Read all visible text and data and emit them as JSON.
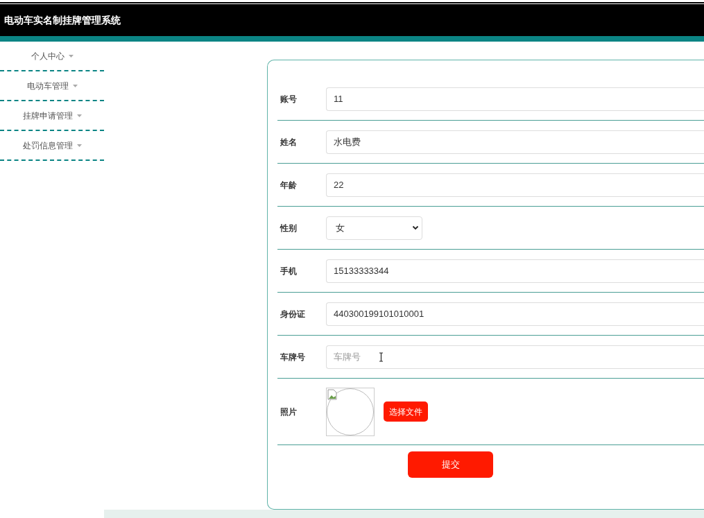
{
  "header": {
    "title": "电动车实名制挂牌管理系统"
  },
  "sidebar": {
    "items": [
      {
        "label": "个人中心",
        "expanded": false
      },
      {
        "label": "电动车管理",
        "expanded": false
      },
      {
        "label": "挂牌申请管理",
        "expanded": false
      },
      {
        "label": "处罚信息管理",
        "expanded": false
      }
    ]
  },
  "form": {
    "fields": [
      {
        "kind": "text",
        "label": "账号",
        "value": "11"
      },
      {
        "kind": "text",
        "label": "姓名",
        "value": "水电费"
      },
      {
        "kind": "text",
        "label": "年龄",
        "value": "22"
      },
      {
        "kind": "select",
        "label": "性别",
        "value": "女"
      },
      {
        "kind": "text",
        "label": "手机",
        "value": "15133333344"
      },
      {
        "kind": "text",
        "label": "身份证",
        "value": "440300199101010001"
      },
      {
        "kind": "text",
        "label": "车牌号",
        "placeholder": "车牌号"
      },
      {
        "kind": "file",
        "label": "照片",
        "button": "选择文件"
      }
    ],
    "submit": "提交"
  }
}
